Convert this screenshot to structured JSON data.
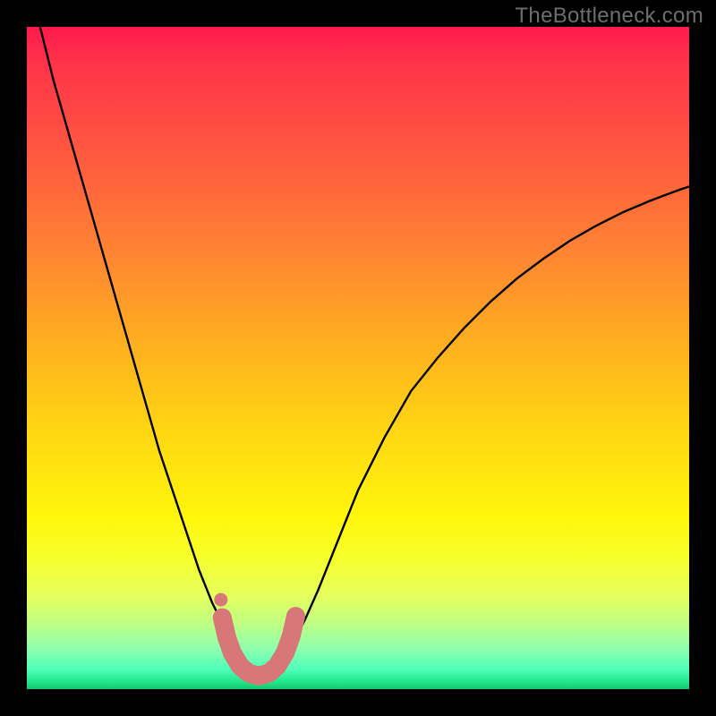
{
  "watermark": "TheBottleneck.com",
  "chart_data": {
    "type": "line",
    "title": "",
    "xlabel": "",
    "ylabel": "",
    "xlim": [
      0,
      100
    ],
    "ylim": [
      0,
      100
    ],
    "curve": {
      "description": "Single V-shaped bottleneck curve plotted over a vertical red-to-green gradient background. Values are percentages of the 740x740 plot area height measured from the top (0 = top, 100 = bottom).",
      "x_pct": [
        0,
        2,
        4,
        6,
        8,
        10,
        12,
        14,
        16,
        18,
        20,
        22,
        24,
        26,
        28,
        30,
        31,
        32,
        33,
        34,
        35,
        36,
        37,
        38,
        39,
        40,
        42,
        44,
        46,
        48,
        50,
        54,
        58,
        62,
        66,
        70,
        74,
        78,
        82,
        86,
        90,
        94,
        98,
        100
      ],
      "y_pct_from_top": [
        -10,
        0,
        8,
        15,
        22,
        29,
        36,
        43,
        50,
        57,
        64,
        70,
        76,
        82,
        87,
        91,
        93,
        95,
        96.5,
        97.5,
        98,
        98,
        97.5,
        96.5,
        95.2,
        93.5,
        89.5,
        85,
        80,
        75,
        70,
        62,
        55,
        50,
        45.5,
        41.5,
        38,
        35,
        32.3,
        30,
        28,
        26.3,
        24.8,
        24.1
      ]
    },
    "markers": {
      "description": "Thick pink U-shaped overlay of connected dots near the curve minimum.",
      "color": "#d77777",
      "points_pct": [
        {
          "x": 29.5,
          "y": 89.2
        },
        {
          "x": 30.2,
          "y": 92.2
        },
        {
          "x": 31.0,
          "y": 94.5
        },
        {
          "x": 32.2,
          "y": 96.5
        },
        {
          "x": 33.5,
          "y": 97.6
        },
        {
          "x": 35.0,
          "y": 98.0
        },
        {
          "x": 36.5,
          "y": 97.6
        },
        {
          "x": 37.8,
          "y": 96.5
        },
        {
          "x": 39.0,
          "y": 94.5
        },
        {
          "x": 39.9,
          "y": 92.0
        },
        {
          "x": 40.6,
          "y": 89.0
        }
      ],
      "isolated_dot_pct": {
        "x": 29.3,
        "y": 86.5
      }
    }
  }
}
